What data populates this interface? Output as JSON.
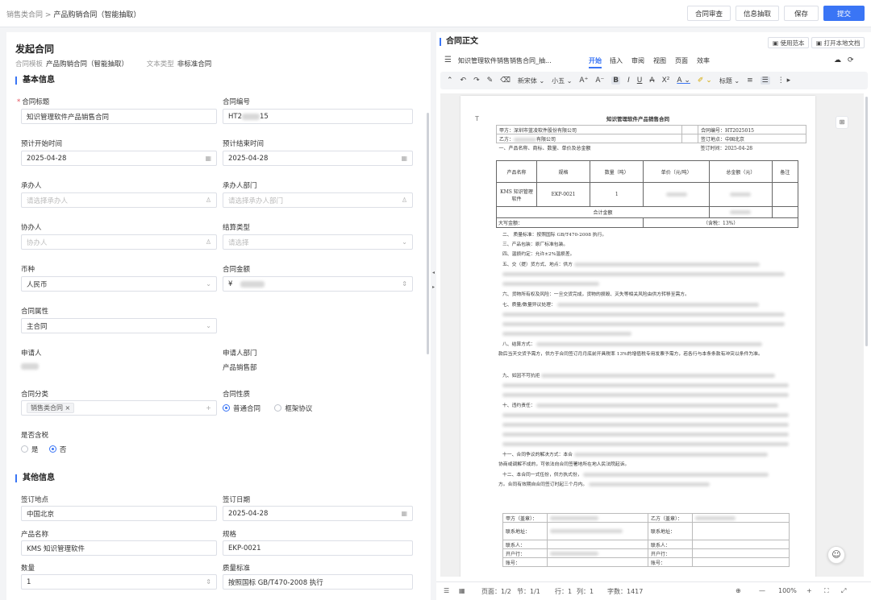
{
  "breadcrumb": {
    "parent": "销售类合同",
    "sep": ">",
    "current": "产品购销合同（智能抽取）"
  },
  "top_actions": {
    "review": "合同审查",
    "extract": "信息抽取",
    "save": "保存",
    "submit": "提交"
  },
  "form": {
    "title": "发起合同",
    "template_label": "合同模板",
    "template_value": "产品购销合同（智能抽取）",
    "text_type_label": "文本类型",
    "text_type_value": "非标准合同"
  },
  "basic": {
    "section": "基本信息",
    "contract_title_label": "合同标题",
    "contract_title_value": "知识管理软件产品销售合同",
    "contract_no_label": "合同编号",
    "contract_no_prefix": "HT2",
    "contract_no_suffix": "15",
    "start_label": "预计开始时间",
    "start_value": "2025-04-28",
    "end_label": "预计结束时间",
    "end_value": "2025-04-28",
    "handler_label": "承办人",
    "handler_placeholder": "请选择承办人",
    "handler_dept_label": "承办人部门",
    "handler_dept_placeholder": "请选择承办人部门",
    "co_handler_label": "协办人",
    "co_handler_placeholder": "协办人",
    "settle_label": "结算类型",
    "settle_placeholder": "请选择",
    "currency_label": "币种",
    "currency_value": "人民币",
    "amount_label": "合同金额",
    "amount_prefix": "¥",
    "attr_label": "合同属性",
    "attr_value": "主合同",
    "applicant_label": "申请人",
    "applicant_dept_label": "申请人部门",
    "applicant_dept_value": "产品销售部",
    "category_label": "合同分类",
    "category_tag": "销售类合同",
    "nature_label": "合同性质",
    "nature_opt1": "普通合同",
    "nature_opt2": "框架协议",
    "tax_label": "是否含税",
    "tax_yes": "是",
    "tax_no": "否"
  },
  "other": {
    "section": "其他信息",
    "sign_place_label": "签订地点",
    "sign_place_value": "中国北京",
    "sign_date_label": "签订日期",
    "sign_date_value": "2025-04-28",
    "product_label": "产品名称",
    "product_value": "KMS 知识管理软件",
    "spec_label": "规格",
    "spec_value": "EKP-0021",
    "qty_label": "数量",
    "qty_value": "1",
    "quality_label": "质量标准",
    "quality_value": "按照国标 GB/T470-2008 执行"
  },
  "doc_panel": {
    "title": "合同正文",
    "use_template": "使用范本",
    "open_local": "打开本地文档",
    "doc_name": "知识管理软件销售销售合同_抽...",
    "tabs": [
      "开始",
      "插入",
      "审阅",
      "视图",
      "页面",
      "效率"
    ],
    "font_name": "新宋体",
    "font_size": "小五",
    "style_label": "标题"
  },
  "doc": {
    "title": "知识管理软件产品销售合同",
    "party_a": "甲方：深圳市蓝凌软件股份有限公司",
    "contract_no": "合同编号：HT2025015",
    "party_b_suffix": "有限公司",
    "party_b_prefix": "乙方：",
    "sign_place": "签订地点：中国北京",
    "sec1": "一、产品名称、商标、数量、单价及总金额",
    "sign_time": "签订时间：2025-04-28",
    "th_name": "产品名称",
    "th_spec": "规格",
    "th_qty": "数量（吨）",
    "th_price": "单价（元/吨）",
    "th_total": "总金额（元）",
    "th_remark": "备注",
    "row_name": "KMS 知识管理软件",
    "row_spec": "EKP-0021",
    "row_qty": "1",
    "sum_label": "合计金额",
    "upper_label": "大写金额：",
    "tax_note": "（含税：13%）",
    "p2": "二、 质量标准：按照国际 GB/T470-2008 执行。",
    "p3": "三、产品包装：原厂标准包装。",
    "p4": "四、温损约定：允许±2%温损差。",
    "p5": "五、交（提）货方式、地点：供方",
    "p6": "六、货物所有权及风险：一旦交货完成，货物的损毁、灭失等相关风险由供方转移至需方。",
    "p7": "七、质量/数量异议处理：",
    "p8": "八、结算方式：",
    "p8b": "款后当天交货予需方，供方于合同签订月月底前开具税率 13%的增值税专用发票予需方，若各行与本条条款有冲突以条件为准。",
    "p9": "九、如因不可抗拒",
    "p10": "十、违约责任：",
    "p11": "十一、合同争议的解决方式：本合",
    "p11b": "协商或调解不成的，可依法向合同签署地所在地人民法院起诉。",
    "p12": "十二、本合同一式伍份，供方执式份，",
    "p12b": "方。合同有效期自合同签订时起三个月内。",
    "sig_a": "甲方（盖章）：",
    "sig_b": "乙方（盖章）：",
    "sig_addr": "联系地址：",
    "sig_contact": "联系人：",
    "sig_bank": "开户行：",
    "sig_acct": "账号："
  },
  "status": {
    "page": "页面：1/2",
    "section": "节：1/1",
    "row": "行：1",
    "col": "列：1",
    "words": "字数：1417",
    "zoom": "100%"
  }
}
